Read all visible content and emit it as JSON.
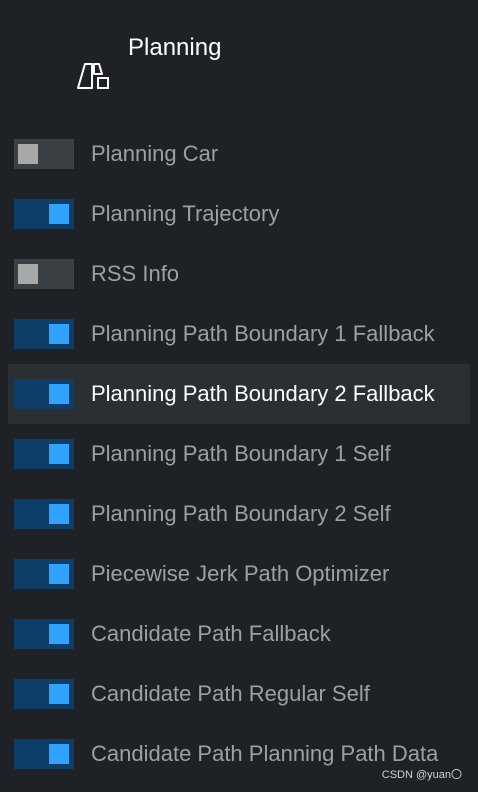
{
  "header": {
    "title": "Planning",
    "icon": "planning-layout-icon"
  },
  "layers": [
    {
      "label": "Planning Car",
      "enabled": false,
      "active": false
    },
    {
      "label": "Planning Trajectory",
      "enabled": true,
      "active": false
    },
    {
      "label": "RSS Info",
      "enabled": false,
      "active": false
    },
    {
      "label": "Planning Path Boundary 1 Fallback",
      "enabled": true,
      "active": false
    },
    {
      "label": "Planning Path Boundary 2 Fallback",
      "enabled": true,
      "active": true
    },
    {
      "label": "Planning Path Boundary 1 Self",
      "enabled": true,
      "active": false
    },
    {
      "label": "Planning Path Boundary 2 Self",
      "enabled": true,
      "active": false
    },
    {
      "label": "Piecewise Jerk Path Optimizer",
      "enabled": true,
      "active": false
    },
    {
      "label": "Candidate Path Fallback",
      "enabled": true,
      "active": false
    },
    {
      "label": "Candidate Path Regular Self",
      "enabled": true,
      "active": false
    },
    {
      "label": "Candidate Path Planning Path Data",
      "enabled": true,
      "active": false
    }
  ],
  "watermark": "CSDN @yuan〇",
  "colors": {
    "background": "#1e2226",
    "toggle_on_track": "#0e3d68",
    "toggle_on_knob": "#30a2ff",
    "toggle_off_track": "#3b4045",
    "toggle_off_knob": "#a8a8a8",
    "active_row": "#2a2f34"
  }
}
